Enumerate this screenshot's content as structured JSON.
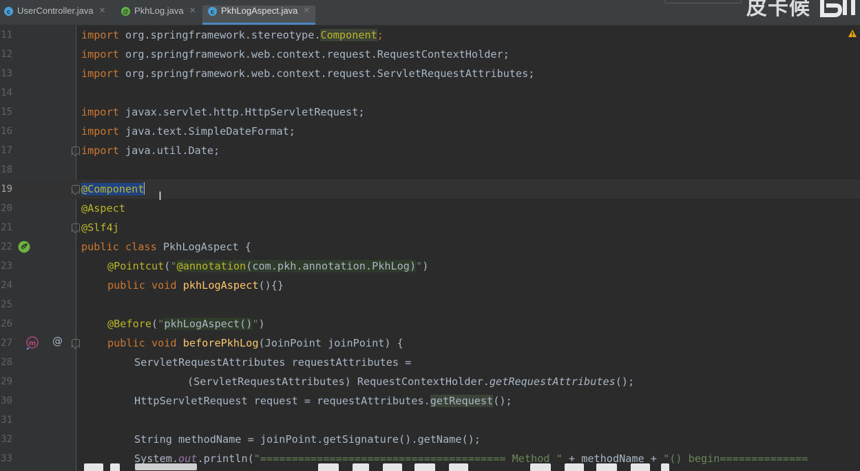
{
  "tabs": [
    {
      "label": "UserController.java",
      "icon": "class-c-icon",
      "color": "#4a9ed6",
      "active": false
    },
    {
      "label": "PkhLog.java",
      "icon": "annotation-icon",
      "color": "#62b543",
      "active": false
    },
    {
      "label": "PkhLogAspect.java",
      "icon": "class-c-icon",
      "color": "#4a9ed6",
      "active": true
    }
  ],
  "watermark": "皮卡候",
  "line_numbers": [
    "11",
    "12",
    "13",
    "14",
    "15",
    "16",
    "17",
    "18",
    "19",
    "20",
    "21",
    "22",
    "23",
    "24",
    "25",
    "26",
    "27",
    "28",
    "29",
    "30",
    "31",
    "32",
    "33"
  ],
  "code": {
    "l11": {
      "kw": "import",
      "pkg": "org.springframework.stereotype.",
      "cls": "Component",
      "end": ";"
    },
    "l12": {
      "kw": "import",
      "rest": "org.springframework.web.context.request.RequestContextHolder;"
    },
    "l13": {
      "kw": "import",
      "rest": "org.springframework.web.context.request.ServletRequestAttributes;"
    },
    "l15": {
      "kw": "import",
      "rest": "javax.servlet.http.HttpServletRequest;"
    },
    "l16": {
      "kw": "import",
      "rest": "java.text.SimpleDateFormat;"
    },
    "l17": {
      "kw": "import",
      "rest": "java.util.Date;"
    },
    "l19": {
      "ann": "@Component"
    },
    "l20": {
      "ann": "@Aspect"
    },
    "l21": {
      "ann": "@Slf4j"
    },
    "l22": {
      "kw": "public class",
      "name": "PkhLogAspect",
      "end": "{"
    },
    "l23": {
      "ann": "@Pointcut",
      "open": "(",
      "q1": "\"",
      "inner_ann": "@annotation",
      "inner": "(com.pkh.annotation.PkhLog)",
      "q2": "\"",
      "close": ")"
    },
    "l24": {
      "kw": "public void",
      "name": "pkhLogAspect",
      "end": "(){}"
    },
    "l26": {
      "ann": "@Before",
      "open": "(",
      "q1": "\"",
      "inner": "pkhLogAspect()",
      "q2": "\"",
      "close": ")"
    },
    "l27": {
      "kw": "public void",
      "name": "beforePkhLog",
      "end": "(JoinPoint joinPoint) {"
    },
    "l28": {
      "text": "ServletRequestAttributes requestAttributes ="
    },
    "l29": {
      "pre": "(ServletRequestAttributes) RequestContextHolder.",
      "call": "getRequestAttributes",
      "end": "();"
    },
    "l30": {
      "pre": "HttpServletRequest request = requestAttributes.",
      "call": "getRequest",
      "end": "();"
    },
    "l32": {
      "text": "String methodName = joinPoint.getSignature().getName();"
    },
    "l33": {
      "pre": "System.",
      "field": "out",
      "mid": ".println(",
      "str1": "\"======================================= Method \"",
      "mid2": " + methodName + ",
      "str2": "\"() begin=============="
    }
  },
  "colors": {
    "background": "#2b2b2b",
    "keyword": "#cc7832",
    "annotation": "#bbb529",
    "string": "#6a8759",
    "method": "#ffc66d",
    "selection": "#214283"
  }
}
